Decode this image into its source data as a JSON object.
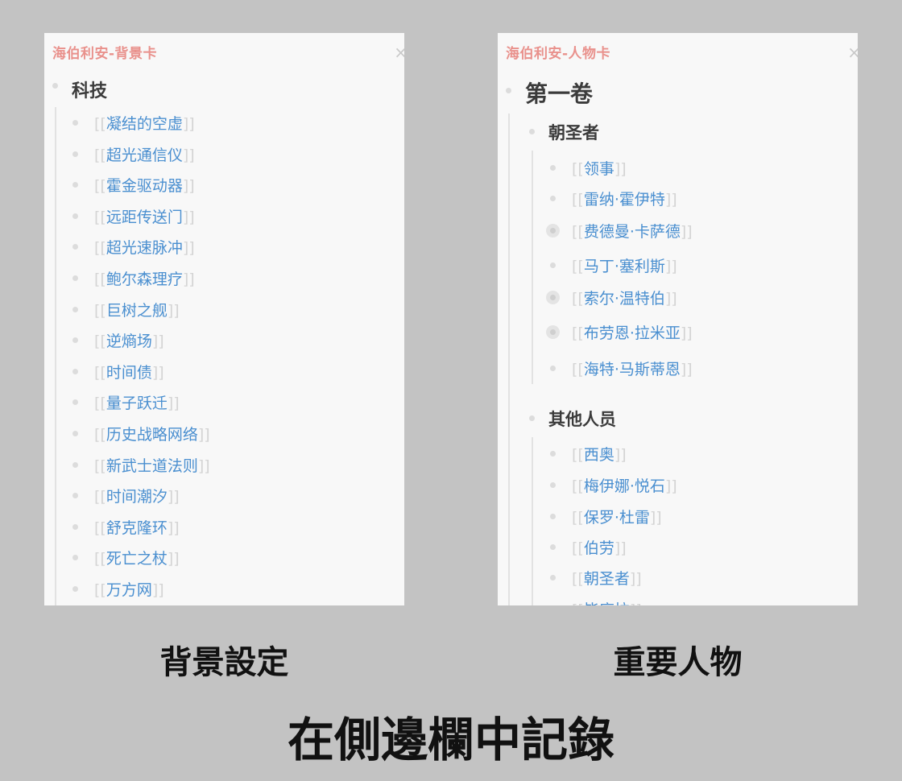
{
  "left_panel": {
    "title": "海伯利安-背景卡",
    "close_icon": "close-icon",
    "section": "科技",
    "items": [
      "凝结的空虚",
      "超光通信仪",
      "霍金驱动器",
      "远距传送门",
      "超光速脉冲",
      "鲍尔森理疗",
      "巨树之舰",
      "逆熵场",
      "时间债",
      "量子跃迁",
      "历史战略网络",
      "新武士道法则",
      "时间潮汐",
      "舒克隆环",
      "死亡之杖",
      "万方网"
    ]
  },
  "right_panel": {
    "title": "海伯利安-人物卡",
    "close_icon": "close-icon",
    "volume": "第一卷",
    "groups": [
      {
        "name": "朝圣者",
        "items": [
          {
            "text": "领事",
            "collapsed": false
          },
          {
            "text": "雷纳·霍伊特",
            "collapsed": false
          },
          {
            "text": "费德曼·卡萨德",
            "collapsed": true
          },
          {
            "text": "马丁·塞利斯",
            "collapsed": false
          },
          {
            "text": "索尔·温特伯",
            "collapsed": true
          },
          {
            "text": "布劳恩·拉米亚",
            "collapsed": true
          },
          {
            "text": "海特·马斯蒂恩",
            "collapsed": false
          }
        ]
      },
      {
        "name": "其他人员",
        "items": [
          {
            "text": "西奥",
            "collapsed": false
          },
          {
            "text": "梅伊娜·悦石",
            "collapsed": false
          },
          {
            "text": "保罗·杜雷",
            "collapsed": false
          },
          {
            "text": "伯劳",
            "collapsed": false
          },
          {
            "text": "朝圣者",
            "collapsed": false
          },
          {
            "text": "毕底拉",
            "collapsed": false
          }
        ]
      }
    ]
  },
  "captions": {
    "left": "背景設定",
    "right": "重要人物",
    "main": "在側邊欄中記錄"
  },
  "colors": {
    "background": "#c3c3c3",
    "panel": "#f8f8f8",
    "title": "#e9918c",
    "link": "#4a8fd0",
    "heading": "#3b3b3b"
  }
}
